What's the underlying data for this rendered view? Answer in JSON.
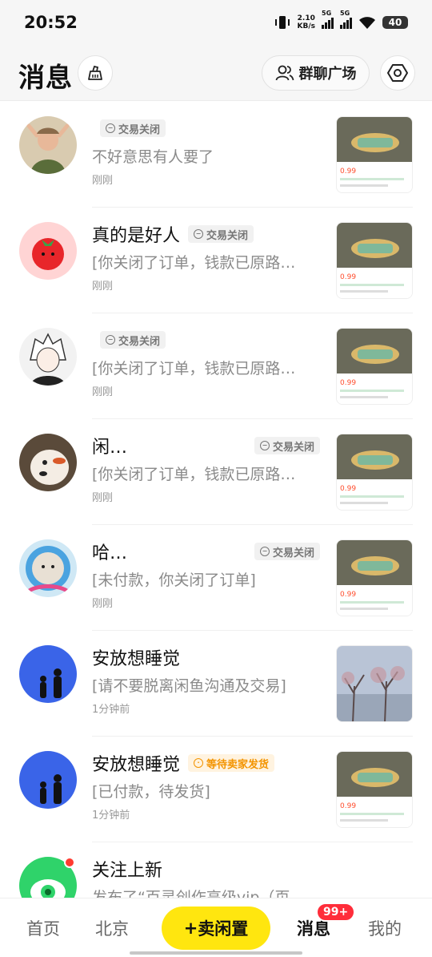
{
  "status_bar": {
    "time": "20:52",
    "net_speed": "2.10",
    "net_unit": "KB/s",
    "sig1": "5G",
    "sig2": "5G",
    "battery": "40"
  },
  "header": {
    "title": "消息",
    "group_chat": "群聊广场"
  },
  "messages": [
    {
      "name": "",
      "status": "交易关闭",
      "preview": "不好意思有人要了",
      "time": "刚刚",
      "avatar_icon": "child-photo-avatar",
      "thumb_price": "0.99"
    },
    {
      "name": "真的是好人",
      "status": "交易关闭",
      "preview": "[你关闭了订单，钱款已原路…",
      "time": "刚刚",
      "avatar_icon": "tomato-avatar",
      "thumb_price": "0.99"
    },
    {
      "name": "",
      "status": "交易关闭",
      "preview": "[你关闭了订单，钱款已原路…",
      "time": "刚刚",
      "avatar_icon": "anime-boy-avatar",
      "thumb_price": "0.99"
    },
    {
      "name": "闲…",
      "status": "交易关闭",
      "preview": "[你关闭了订单，钱款已原路…",
      "time": "刚刚",
      "avatar_icon": "dog-avatar",
      "thumb_price": "0.99"
    },
    {
      "name": "哈…",
      "status": "交易关闭",
      "preview": "[未付款，你关闭了订单]",
      "time": "刚刚",
      "avatar_icon": "cat-astronaut-avatar",
      "thumb_price": "0.99"
    },
    {
      "name": "安放想睡觉",
      "status": "",
      "preview": "[请不要脱离闲鱼沟通及交易]",
      "time": "1分钟前",
      "avatar_icon": "silhouette-avatar",
      "thumb_price": ""
    },
    {
      "name": "安放想睡觉",
      "status": "等待卖家发货",
      "preview": "[已付款，待发货]",
      "time": "1分钟前",
      "avatar_icon": "silhouette-avatar",
      "thumb_price": "0.99"
    },
    {
      "name": "关注上新",
      "status": "",
      "preview": "发布了“百灵创作高级vip（页…",
      "time": "",
      "avatar_icon": "eye-avatar",
      "thumb_price": ""
    }
  ],
  "tab_bar": {
    "home": "首页",
    "city": "北京",
    "sell": "卖闲置",
    "messages": "消息",
    "messages_badge": "99+",
    "mine": "我的"
  },
  "colors": {
    "accent_yellow": "#ffe60f",
    "badge_red": "#ff2d3a",
    "status_orange": "#f39400"
  }
}
